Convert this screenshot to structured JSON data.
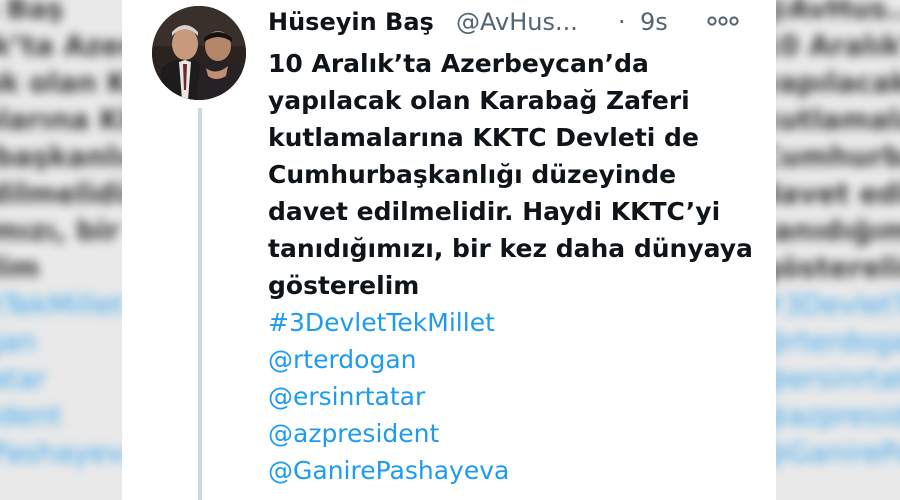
{
  "tweet": {
    "author_name": "Hüseyin Baş",
    "author_handle": "@AvHus...",
    "separator": "·",
    "time": "9s",
    "more_icon": "more-options-icon",
    "text_lines": [
      "10 Aralık’ta Azerbeycan’da",
      "yapılacak olan Karabağ Zaferi",
      "kutlamalarına KKTC Devleti de",
      "Cumhurbaşkanlığı düzeyinde",
      "davet edilmelidir. Haydi KKTC’yi",
      "tanıdığımızı, bir kez daha dünyaya",
      "gösterelim"
    ],
    "links": [
      "#3DevletTekMillet",
      "@rterdogan",
      "@ersinrtatar",
      "@azpresident",
      "@GanirePashayeva"
    ]
  },
  "colors": {
    "link": "#1d9bf0",
    "text": "#0f1419",
    "muted": "#536471",
    "thread_line": "#cfd9de"
  }
}
